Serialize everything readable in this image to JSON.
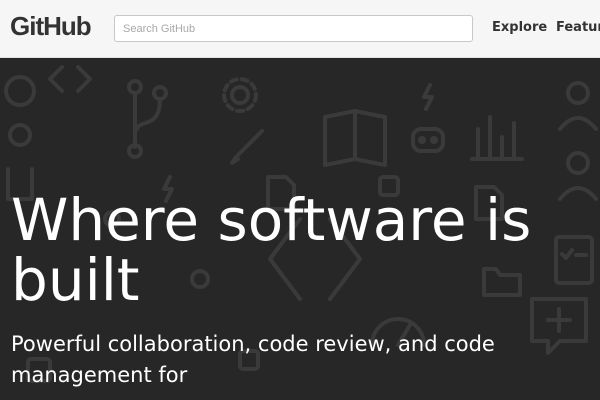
{
  "header": {
    "logo": "GitHub",
    "search": {
      "placeholder": "Search GitHub",
      "value": ""
    },
    "nav": [
      {
        "label": "Explore"
      },
      {
        "label": "Features"
      }
    ]
  },
  "hero": {
    "headline": "Where software is built",
    "subheadline": "Powerful collaboration, code review, and code management for"
  },
  "colors": {
    "hero_background": "#272727",
    "header_background": "#f6f6f6",
    "text_dark": "#333333",
    "text_light": "#ffffff"
  }
}
